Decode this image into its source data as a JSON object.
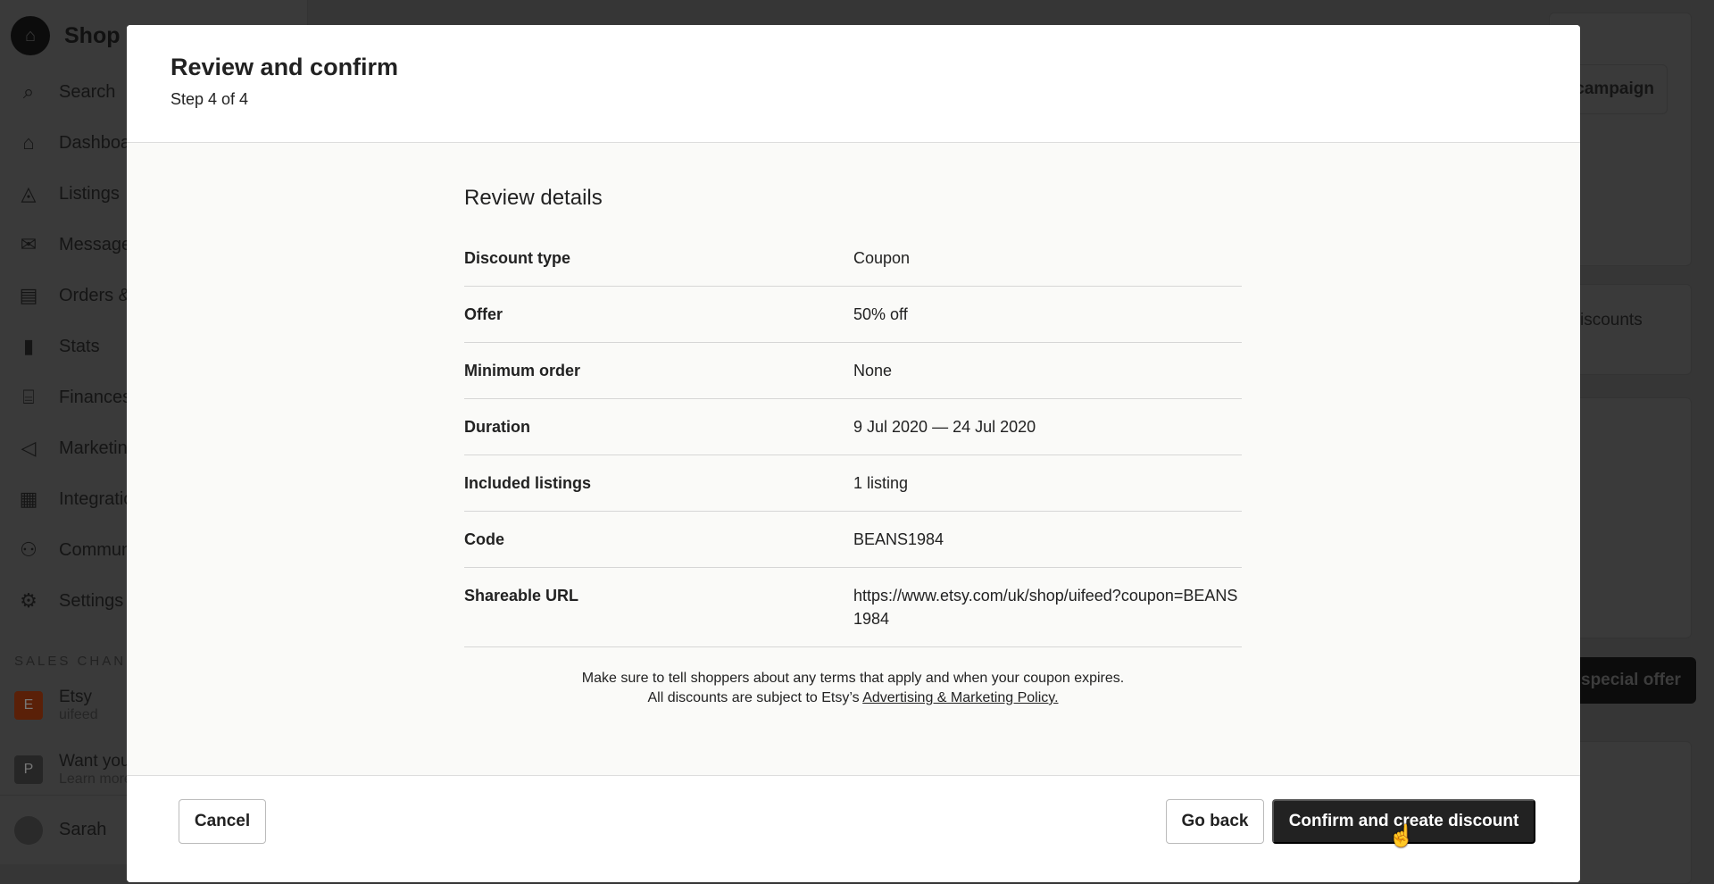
{
  "sidebar": {
    "brand": "Shop Manager",
    "items": [
      {
        "icon": "search-icon",
        "label": "Search"
      },
      {
        "icon": "home-icon",
        "label": "Dashboard"
      },
      {
        "icon": "shapes-icon",
        "label": "Listings"
      },
      {
        "icon": "mail-icon",
        "label": "Messages"
      },
      {
        "icon": "clipboard-icon",
        "label": "Orders & Shipping"
      },
      {
        "icon": "bar-chart-icon",
        "label": "Stats"
      },
      {
        "icon": "bank-icon",
        "label": "Finances"
      },
      {
        "icon": "megaphone-icon",
        "label": "Marketing"
      },
      {
        "icon": "grid-icon",
        "label": "Integrations"
      },
      {
        "icon": "people-icon",
        "label": "Community & Help"
      },
      {
        "icon": "gear-icon",
        "label": "Settings"
      }
    ],
    "section": "SALES CHANNELS",
    "channels": [
      {
        "letter": "E",
        "name": "Etsy",
        "sub": "uifeed",
        "color": "#f1641e"
      },
      {
        "letter": "P",
        "name": "Want your own website?",
        "sub": "Learn more about Pattern",
        "color": "#555555"
      }
    ],
    "user": "Sarah"
  },
  "background": {
    "campaign_btn": "campaign",
    "discounts_text": "iscounts",
    "offer_btn": "special offer"
  },
  "modal": {
    "title": "Review and confirm",
    "step": "Step 4 of 4",
    "section_title": "Review details",
    "rows": [
      {
        "label": "Discount type",
        "value": "Coupon"
      },
      {
        "label": "Offer",
        "value": "50% off"
      },
      {
        "label": "Minimum order",
        "value": "None"
      },
      {
        "label": "Duration",
        "value": "9 Jul 2020 — 24 Jul 2020"
      },
      {
        "label": "Included listings",
        "value": "1 listing"
      },
      {
        "label": "Code",
        "value": "BEANS1984"
      },
      {
        "label": "Shareable URL",
        "value": "https://www.etsy.com/uk/shop/uifeed?coupon=BEANS1984"
      }
    ],
    "note1": "Make sure to tell shoppers about any terms that apply and when your coupon expires.",
    "note2": "All discounts are subject to Etsy’s",
    "policy_link": "Advertising & Marketing Policy.",
    "cancel": "Cancel",
    "go_back": "Go back",
    "confirm": "Confirm and create discount"
  }
}
